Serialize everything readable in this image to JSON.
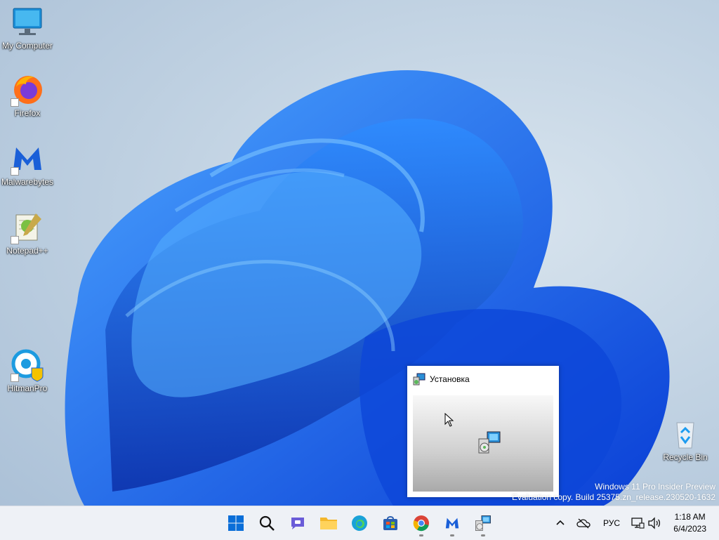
{
  "desktop_icons": [
    {
      "label": "My Computer",
      "icon": "computer-icon"
    },
    {
      "label": "Firefox",
      "icon": "firefox-icon"
    },
    {
      "label": "Malwarebytes",
      "icon": "malwarebytes-icon"
    },
    {
      "label": "Notepad++",
      "icon": "notepadpp-icon"
    },
    {
      "label": "HitmanPro",
      "icon": "hitmanpro-icon"
    },
    {
      "label": "Recycle Bin",
      "icon": "recycle-bin-icon"
    }
  ],
  "installer_window": {
    "title": "Установка",
    "icon": "setup-icon"
  },
  "watermark": {
    "line1": "Windows 11 Pro Insider Preview",
    "line2": "Evaluation copy. Build 25375.zn_release.230520-1632"
  },
  "taskbar": {
    "apps": [
      {
        "name": "Start",
        "icon": "windows-logo-icon"
      },
      {
        "name": "Search",
        "icon": "search-icon"
      },
      {
        "name": "Chat",
        "icon": "teams-chat-icon"
      },
      {
        "name": "File Explorer",
        "icon": "folder-icon"
      },
      {
        "name": "Microsoft Edge",
        "icon": "edge-icon"
      },
      {
        "name": "Microsoft Store",
        "icon": "store-icon"
      },
      {
        "name": "Google Chrome",
        "icon": "chrome-icon"
      },
      {
        "name": "Malwarebytes",
        "icon": "malwarebytes-icon"
      },
      {
        "name": "Setup",
        "icon": "setup-icon"
      }
    ],
    "tray": {
      "language": "РУС",
      "time": "1:18 AM",
      "date": "6/4/2023"
    }
  },
  "colors": {
    "wallpaper_blue": "#1a6bff",
    "taskbar_bg": "#eef1f6"
  }
}
